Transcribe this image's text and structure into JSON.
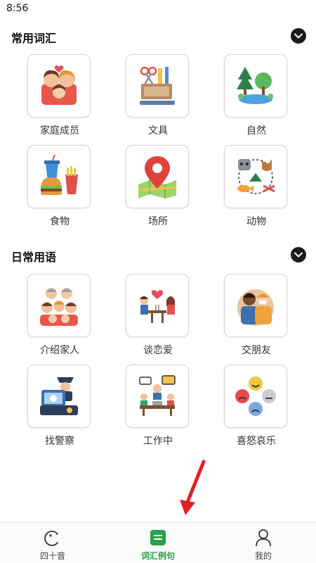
{
  "status_bar": {
    "time": "8:56"
  },
  "sections": [
    {
      "title": "常用词汇",
      "items": [
        {
          "label": "家庭成员",
          "icon": "family-icon"
        },
        {
          "label": "文具",
          "icon": "stationery-icon"
        },
        {
          "label": "自然",
          "icon": "nature-icon"
        },
        {
          "label": "食物",
          "icon": "food-icon"
        },
        {
          "label": "场所",
          "icon": "map-pin-icon"
        },
        {
          "label": "动物",
          "icon": "animals-icon"
        }
      ]
    },
    {
      "title": "日常用语",
      "items": [
        {
          "label": "介绍家人",
          "icon": "family-introduction-icon"
        },
        {
          "label": "谈恋爱",
          "icon": "dating-couple-icon"
        },
        {
          "label": "交朋友",
          "icon": "friends-icon"
        },
        {
          "label": "找警察",
          "icon": "police-icon"
        },
        {
          "label": "工作中",
          "icon": "office-meeting-icon"
        },
        {
          "label": "喜怒哀乐",
          "icon": "emotions-icon"
        }
      ]
    }
  ],
  "tab_bar": {
    "tabs": [
      {
        "label": "四十音",
        "icon": "kana-icon",
        "active": false
      },
      {
        "label": "词汇例句",
        "icon": "vocabulary-icon",
        "active": true
      },
      {
        "label": "我的",
        "icon": "user-icon",
        "active": false
      }
    ]
  },
  "colors": {
    "accent": "#27a14a",
    "annotation_arrow": "#e02020"
  }
}
